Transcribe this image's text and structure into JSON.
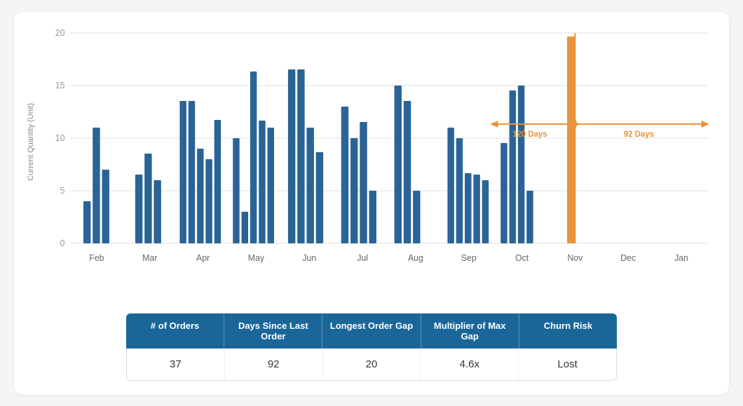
{
  "chart": {
    "y_axis_label": "Current Quantity (Unit)",
    "y_max": 20,
    "y_ticks": [
      0,
      5,
      10,
      15,
      20
    ],
    "x_labels": [
      "Feb",
      "Mar",
      "Apr",
      "May",
      "Jun",
      "Jul",
      "Aug",
      "Sep",
      "Oct",
      "Nov",
      "Dec",
      "Jan"
    ],
    "annotation_120": "120 Days",
    "annotation_92": "92 Days",
    "bars": [
      {
        "month": "Feb",
        "values": [
          4,
          11
        ]
      },
      {
        "month": "Feb2",
        "values": [
          7
        ]
      },
      {
        "month": "Mar",
        "values": [
          6,
          8.5
        ]
      },
      {
        "month": "Mar2",
        "values": [
          6
        ]
      },
      {
        "month": "Apr",
        "values": [
          13.5,
          13.5
        ]
      },
      {
        "month": "Apr2",
        "values": [
          9,
          8,
          11.7
        ]
      },
      {
        "month": "May",
        "values": [
          10,
          11.7,
          3,
          16.3,
          11
        ]
      },
      {
        "month": "Jun",
        "values": [
          16.5,
          16.5,
          11,
          8.7
        ]
      },
      {
        "month": "Jul",
        "values": [
          13,
          10,
          11.5
        ]
      },
      {
        "month": "Jul2",
        "values": [
          5
        ]
      },
      {
        "month": "Aug",
        "values": [
          15,
          13.5,
          5
        ]
      },
      {
        "month": "Sep",
        "values": [
          11,
          10,
          6.7,
          6.5,
          6
        ]
      },
      {
        "month": "Oct",
        "values": [
          9.5,
          14.5,
          15,
          5
        ]
      },
      {
        "month": "Nov",
        "values": [
          19.7
        ]
      },
      {
        "month": "Dec",
        "values": []
      },
      {
        "month": "Jan",
        "values": []
      }
    ]
  },
  "summary": {
    "headers": [
      "# of Orders",
      "Days Since Last Order",
      "Longest Order Gap",
      "Multiplier of Max Gap",
      "Churn Risk"
    ],
    "values": [
      "37",
      "92",
      "20",
      "4.6x",
      "Lost"
    ]
  }
}
